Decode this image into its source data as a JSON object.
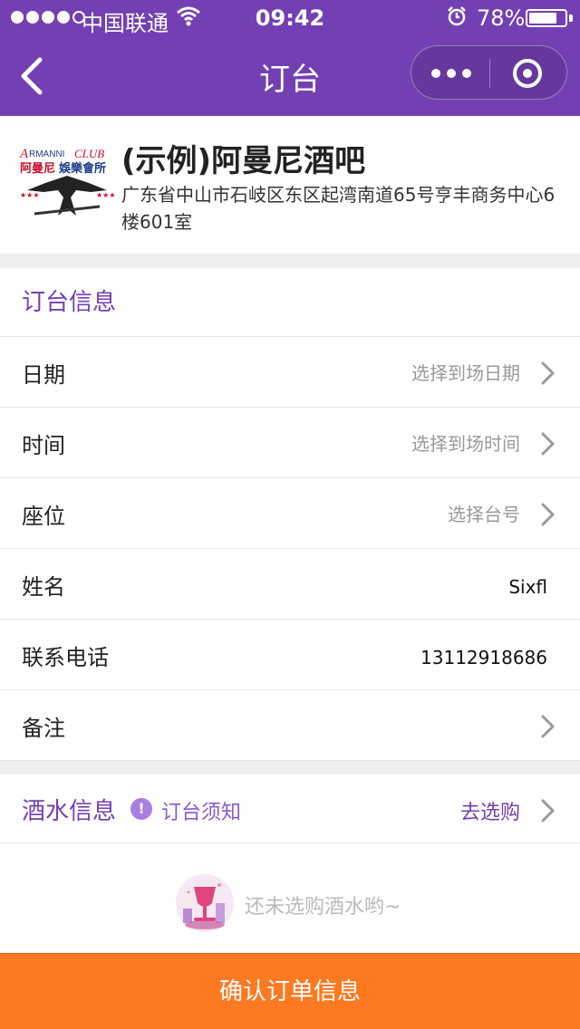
{
  "status_bar": {
    "carrier": "中国联通",
    "time": "09:42",
    "battery_percent": "78%",
    "battery_level": 0.78,
    "signal_bars_filled": 4,
    "icons": [
      "wifi-icon",
      "alarm-icon",
      "battery-icon"
    ]
  },
  "nav": {
    "title": "订台",
    "icons": [
      "back-arrow-icon",
      "more-dots-icon",
      "close-target-icon"
    ]
  },
  "bar": {
    "logo_text_top": "ARMANNICLUB",
    "logo_text_cn": "阿曼尼娛樂會所",
    "name": "(示例)阿曼尼酒吧",
    "address": "广东省中山市石岐区东区起湾南道65号亨丰商务中心6楼601室"
  },
  "booking": {
    "section_title": "订台信息",
    "rows": [
      {
        "label": "日期",
        "value": "选择到场日期",
        "filled": false,
        "chevron": true
      },
      {
        "label": "时间",
        "value": "选择到场时间",
        "filled": false,
        "chevron": true
      },
      {
        "label": "座位",
        "value": "选择台号",
        "filled": false,
        "chevron": true
      },
      {
        "label": "姓名",
        "value": "Sixfl",
        "filled": true,
        "chevron": false
      },
      {
        "label": "联系电话",
        "value": "13112918686",
        "filled": true,
        "chevron": false
      },
      {
        "label": "备注",
        "value": "",
        "filled": false,
        "chevron": true
      }
    ]
  },
  "drinks": {
    "section_title": "酒水信息",
    "notice_icon": "!",
    "notice_label": "订台须知",
    "go_shop_label": "去选购",
    "empty_text": "还未选购酒水哟~"
  },
  "footer": {
    "confirm_label": "确认订单信息"
  },
  "colors": {
    "brand_purple": "#7340b3",
    "confirm_orange": "#fe7a22",
    "placeholder_gray": "#999999"
  }
}
